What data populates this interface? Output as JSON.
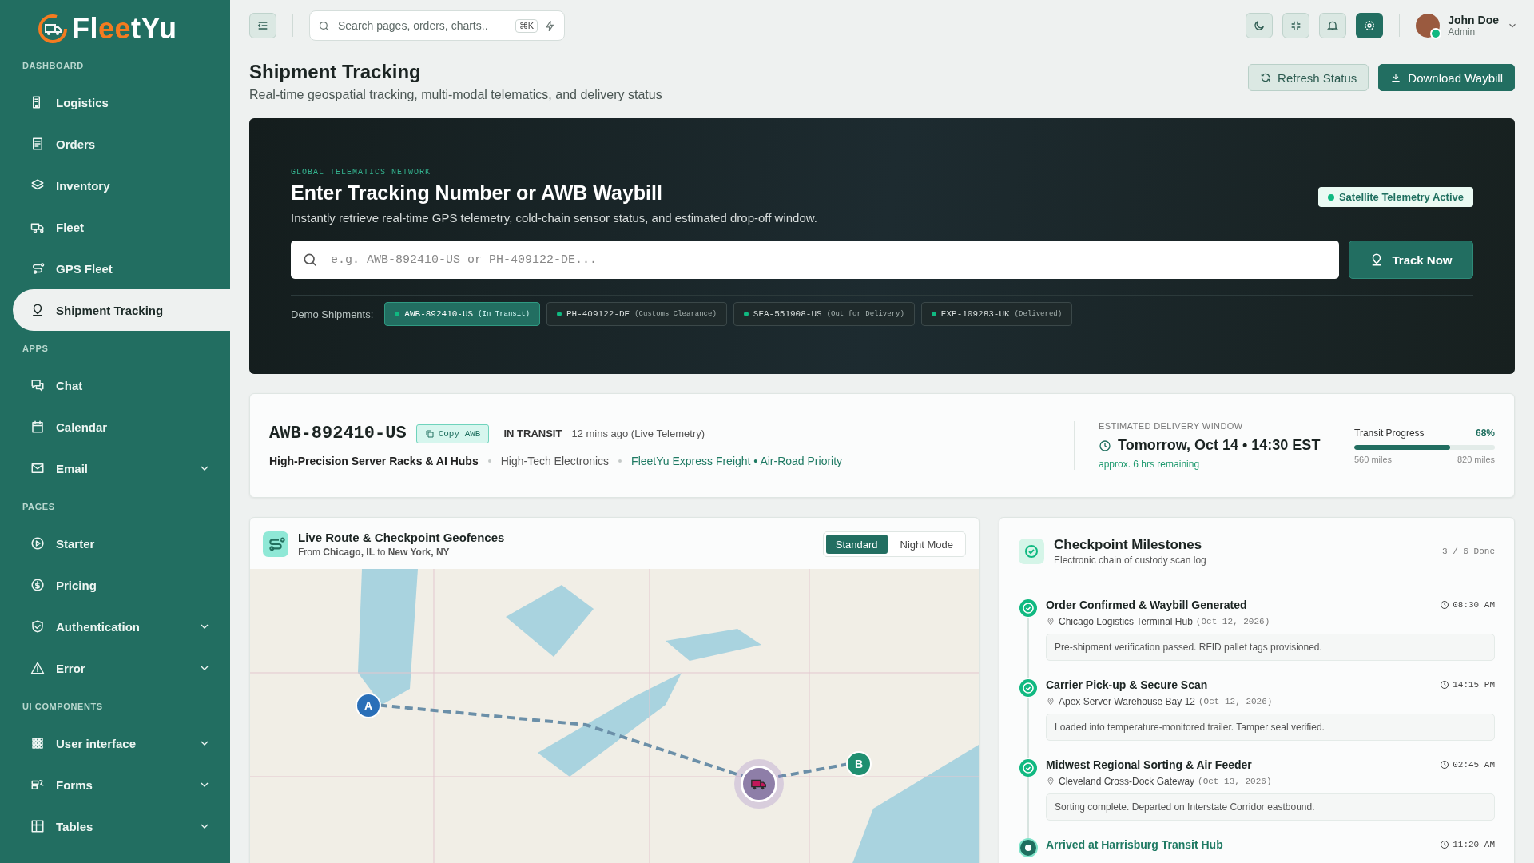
{
  "sidebar": {
    "logo": [
      {
        "text": "Fl",
        "accent": false
      },
      {
        "text": "ee",
        "accent": true
      },
      {
        "text": "tYu",
        "accent": false
      }
    ],
    "sections": [
      {
        "label": "DASHBOARD",
        "items": [
          {
            "label": "Logistics",
            "selected": false,
            "has_submenu": false
          },
          {
            "label": "Orders",
            "selected": false,
            "has_submenu": false
          },
          {
            "label": "Inventory",
            "selected": false,
            "has_submenu": false
          },
          {
            "label": "Fleet",
            "selected": false,
            "has_submenu": false
          },
          {
            "label": "GPS Fleet",
            "selected": false,
            "has_submenu": false
          },
          {
            "label": "Shipment Tracking",
            "selected": true,
            "has_submenu": false
          }
        ]
      },
      {
        "label": "APPS",
        "items": [
          {
            "label": "Chat",
            "selected": false,
            "has_submenu": false
          },
          {
            "label": "Calendar",
            "selected": false,
            "has_submenu": false
          },
          {
            "label": "Email",
            "selected": false,
            "has_submenu": true
          }
        ]
      },
      {
        "label": "PAGES",
        "items": [
          {
            "label": "Starter",
            "selected": false,
            "has_submenu": false
          },
          {
            "label": "Pricing",
            "selected": false,
            "has_submenu": false
          },
          {
            "label": "Authentication",
            "selected": false,
            "has_submenu": true
          },
          {
            "label": "Error",
            "selected": false,
            "has_submenu": true
          }
        ]
      },
      {
        "label": "UI COMPONENTS",
        "items": [
          {
            "label": "User interface",
            "selected": false,
            "has_submenu": true
          },
          {
            "label": "Forms",
            "selected": false,
            "has_submenu": true
          },
          {
            "label": "Tables",
            "selected": false,
            "has_submenu": true
          }
        ]
      }
    ]
  },
  "topbar": {
    "search_placeholder": "Search pages, orders, charts..",
    "shortcut": "⌘K",
    "user": {
      "name": "John Doe",
      "role": "Admin",
      "online": true
    }
  },
  "header": {
    "title": "Shipment Tracking",
    "subtitle": "Real-time geospatial tracking, multi-modal telematics, and delivery status",
    "buttons": [
      {
        "label": "Refresh Status",
        "kind": "secondary"
      },
      {
        "label": "Download Waybill",
        "kind": "primary"
      }
    ]
  },
  "hero": {
    "eyebrow": "GLOBAL TELEMATICS NETWORK",
    "title": "Enter Tracking Number or AWB Waybill",
    "subtitle": "Instantly retrieve real-time GPS telemetry, cold-chain sensor status, and estimated drop-off window.",
    "badge": "Satellite Telemetry Active",
    "placeholder": "e.g. AWB-892410-US or PH-409122-DE...",
    "track_button": "Track Now",
    "demo_label": "Demo Shipments:",
    "demos": [
      {
        "id": "AWB-892410-US",
        "status": "(In Transit)",
        "selected": true
      },
      {
        "id": "PH-409122-DE",
        "status": "(Customs Clearance)",
        "selected": false
      },
      {
        "id": "SEA-551908-US",
        "status": "(Out for Delivery)",
        "selected": false
      },
      {
        "id": "EXP-109283-UK",
        "status": "(Delivered)",
        "selected": false
      }
    ]
  },
  "summary": {
    "awb": "AWB-892410-US",
    "copy_button": "Copy AWB",
    "status": "IN TRANSIT",
    "updated": "12 mins ago (Live Telemetry)",
    "product": "High-Precision Server Racks & AI Hubs",
    "category": "High-Tech Electronics",
    "carrier": "FleetYu Express Freight • Air-Road Priority",
    "eta_label": "ESTIMATED DELIVERY WINDOW",
    "eta": "Tomorrow, Oct 14 • 14:30 EST",
    "remaining": "approx. 6 hrs remaining",
    "progress_label": "Transit Progress",
    "percent": "68%",
    "level": 0.68,
    "start_reading": "560 miles",
    "end_reading": "820 miles"
  },
  "map": {
    "title": "Live Route & Checkpoint Geofences",
    "route": "From **Chicago, IL** to **New York, NY**",
    "modes": [
      {
        "label": "Standard",
        "selected": true
      },
      {
        "label": "Night Mode",
        "selected": false
      }
    ],
    "origin_marker": "A",
    "destination_marker": "B"
  },
  "milestones": {
    "title": "Checkpoint Milestones",
    "subtitle": "Electronic chain of custody scan log",
    "count": "3 / 6 Done",
    "items": [
      {
        "title": "Order Confirmed & Waybill Generated",
        "location": "Chicago Logistics Terminal Hub",
        "date": "(Oct 12, 2026)",
        "note": "Pre-shipment verification passed. RFID pallet tags provisioned.",
        "time": "08:30 AM",
        "kind": "done"
      },
      {
        "title": "Carrier Pick-up & Secure Scan",
        "location": "Apex Server Warehouse Bay 12",
        "date": "(Oct 12, 2026)",
        "note": "Loaded into temperature-monitored trailer. Tamper seal verified.",
        "time": "14:15 PM",
        "kind": "done"
      },
      {
        "title": "Midwest Regional Sorting & Air Feeder",
        "location": "Cleveland Cross-Dock Gateway",
        "date": "(Oct 13, 2026)",
        "note": "Sorting complete. Departed on Interstate Corridor eastbound.",
        "time": "02:45 AM",
        "kind": "done"
      },
      {
        "title": "Arrived at Harrisburg Transit Hub",
        "time": "11:20 AM",
        "kind": "current"
      }
    ]
  }
}
